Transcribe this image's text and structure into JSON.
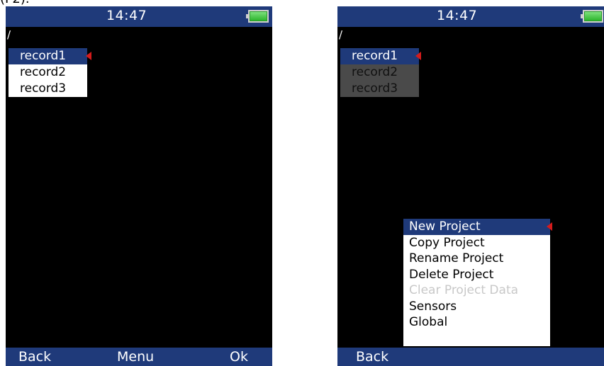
{
  "caption": "(F2).",
  "colors": {
    "title_bar": "#1f3a7a",
    "selection": "#1f3a7a",
    "marker": "#d41b1b",
    "battery": "#2db52d",
    "disabled_text": "#c8c8c8"
  },
  "left_screen": {
    "time": "14:47",
    "path": "/",
    "records": [
      {
        "label": "record1",
        "selected": true
      },
      {
        "label": "record2",
        "selected": false
      },
      {
        "label": "record3",
        "selected": false
      }
    ],
    "softkeys": {
      "back": "Back",
      "menu": "Menu",
      "ok": "Ok"
    }
  },
  "right_screen": {
    "time": "14:47",
    "path": "/",
    "records": [
      {
        "label": "record1",
        "selected": true
      },
      {
        "label": "record2",
        "selected": false
      },
      {
        "label": "record3",
        "selected": false
      }
    ],
    "menu": [
      {
        "label": "New Project",
        "selected": true,
        "enabled": true
      },
      {
        "label": "Copy Project",
        "selected": false,
        "enabled": true
      },
      {
        "label": "Rename Project",
        "selected": false,
        "enabled": true
      },
      {
        "label": "Delete Project",
        "selected": false,
        "enabled": true
      },
      {
        "label": "Clear Project Data",
        "selected": false,
        "enabled": false
      },
      {
        "label": "Sensors",
        "selected": false,
        "enabled": true
      },
      {
        "label": "Global",
        "selected": false,
        "enabled": true
      }
    ],
    "softkeys": {
      "back": "Back"
    }
  }
}
